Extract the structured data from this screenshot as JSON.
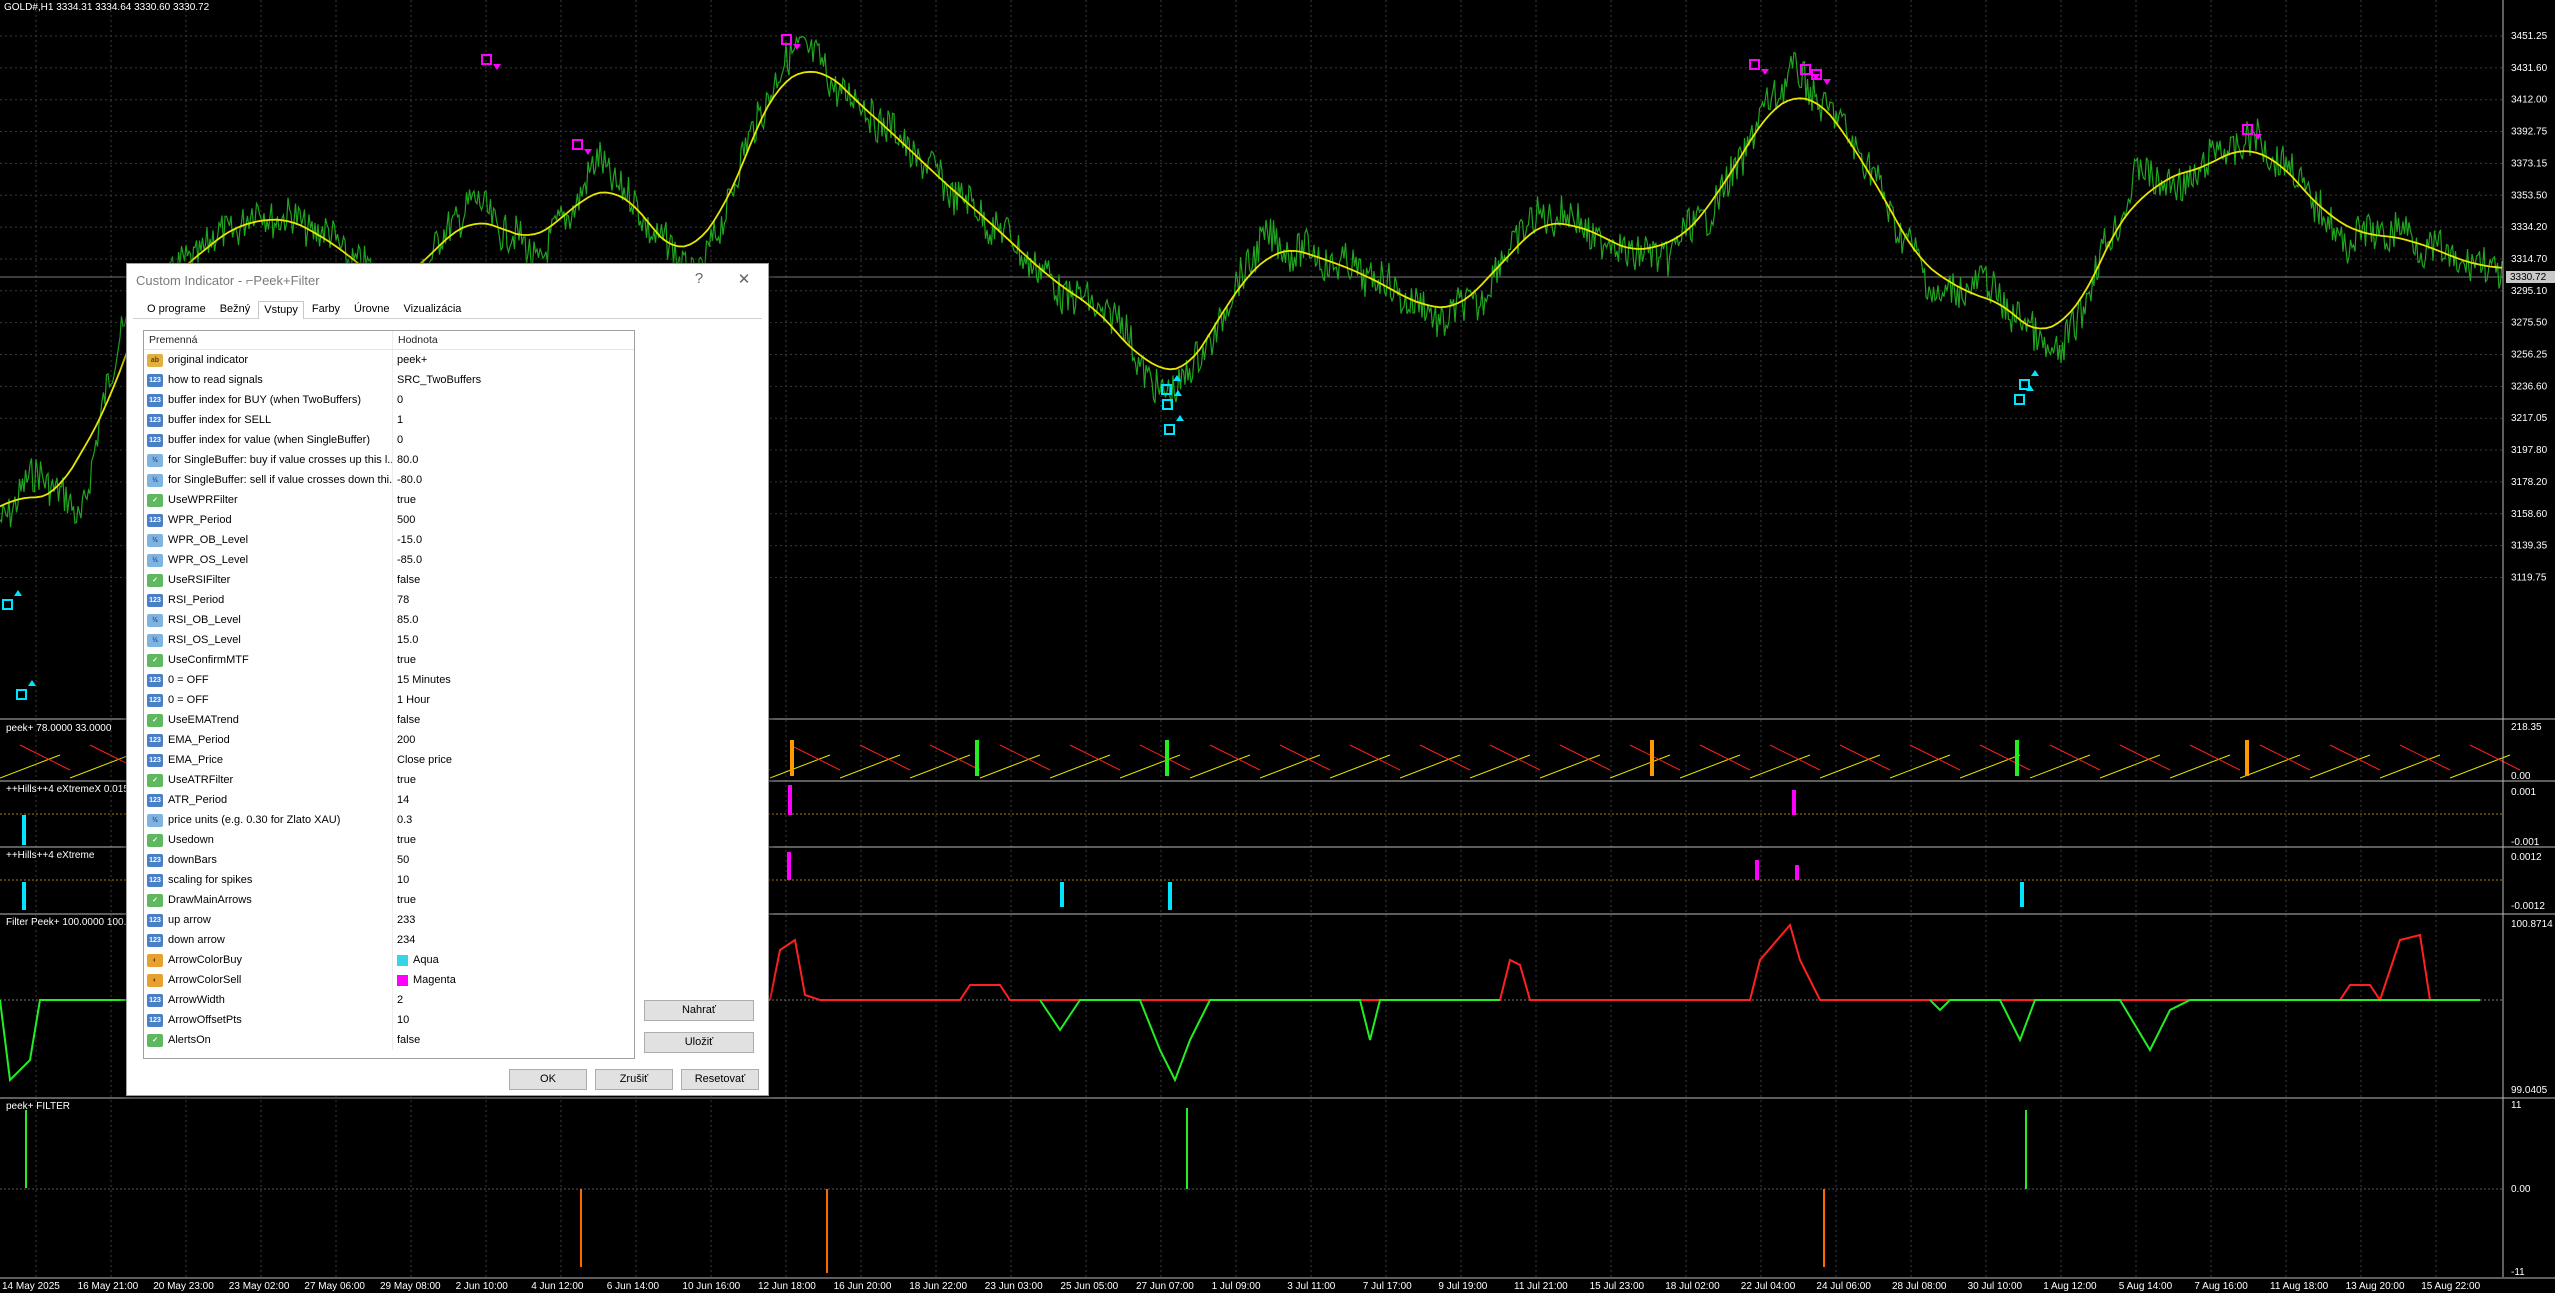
{
  "chart_header": "GOLD#,H1  3334.31 3334.64 3330.60 3330.72",
  "price_axis": [
    "3451.25",
    "3431.60",
    "3412.00",
    "3392.75",
    "3373.15",
    "3353.50",
    "3334.20",
    "3314.70",
    "3295.10",
    "3275.50",
    "3256.25",
    "3236.60",
    "3217.05",
    "3197.80",
    "3178.20",
    "3158.60",
    "3139.35",
    "3119.75"
  ],
  "current_price": "3330.72",
  "date_axis": [
    "14 May 2025",
    "16 May 21:00",
    "20 May 23:00",
    "23 May 02:00",
    "27 May 06:00",
    "29 May 08:00",
    "2 Jun 10:00",
    "4 Jun 12:00",
    "6 Jun 14:00",
    "10 Jun 16:00",
    "12 Jun 18:00",
    "16 Jun 20:00",
    "18 Jun 22:00",
    "23 Jun 03:00",
    "25 Jun 05:00",
    "27 Jun 07:00",
    "1 Jul 09:00",
    "3 Jul 11:00",
    "7 Jul 17:00",
    "9 Jul 19:00",
    "11 Jul 21:00",
    "15 Jul 23:00",
    "18 Jul 02:00",
    "22 Jul 04:00",
    "24 Jul 06:00",
    "28 Jul 08:00",
    "30 Jul 10:00",
    "1 Aug 12:00",
    "5 Aug 14:00",
    "7 Aug 16:00",
    "11 Aug 18:00",
    "13 Aug 20:00",
    "15 Aug 22:00"
  ],
  "subwindows": [
    {
      "label": "peek+ 78.0000 33.0000",
      "scale": [
        "218.35",
        "0.00"
      ]
    },
    {
      "label": "++Hills++4 eXtremeX 0.015",
      "scale": [
        "0.001",
        "-0.001"
      ]
    },
    {
      "label": "++Hills++4 eXtreme",
      "scale": [
        "0.0012",
        "-0.0012"
      ]
    },
    {
      "label": "Filter Peek+ 100.0000 100.0000",
      "scale": [
        "100.8714",
        "99.0405"
      ]
    },
    {
      "label": "peek+ FILTER",
      "scale": [
        "11",
        "0.00",
        "-11"
      ]
    }
  ],
  "dialog": {
    "title": "Custom Indicator - ⌐Peek+Filter",
    "help": "?",
    "close": "✕",
    "tabs": [
      "O programe",
      "Bežný",
      "Vstupy",
      "Farby",
      "Úrovne",
      "Vizualizácia"
    ],
    "active_tab": "Vstupy",
    "col_name": "Premenná",
    "col_value": "Hodnota",
    "params": [
      {
        "type": "ab",
        "name": "original indicator",
        "value": "peek+"
      },
      {
        "type": "enm",
        "name": "how to read signals",
        "value": "SRC_TwoBuffers"
      },
      {
        "type": "int",
        "name": "buffer index for BUY (when TwoBuffers)",
        "value": "0"
      },
      {
        "type": "int",
        "name": "buffer index for SELL",
        "value": "1"
      },
      {
        "type": "int",
        "name": "buffer index for value (when SingleBuffer)",
        "value": "0"
      },
      {
        "type": "dbl",
        "name": "for SingleBuffer: buy if value crosses up this l...",
        "value": "80.0"
      },
      {
        "type": "dbl",
        "name": "for SingleBuffer: sell if value crosses down thi...",
        "value": "-80.0"
      },
      {
        "type": "bool",
        "name": "UseWPRFilter",
        "value": "true"
      },
      {
        "type": "int",
        "name": "WPR_Period",
        "value": "500"
      },
      {
        "type": "dbl",
        "name": "WPR_OB_Level",
        "value": "-15.0"
      },
      {
        "type": "dbl",
        "name": "WPR_OS_Level",
        "value": "-85.0"
      },
      {
        "type": "bool",
        "name": "UseRSIFilter",
        "value": "false"
      },
      {
        "type": "int",
        "name": "RSI_Period",
        "value": "78"
      },
      {
        "type": "dbl",
        "name": "RSI_OB_Level",
        "value": "85.0"
      },
      {
        "type": "dbl",
        "name": "RSI_OS_Level",
        "value": "15.0"
      },
      {
        "type": "bool",
        "name": "UseConfirmMTF",
        "value": "true"
      },
      {
        "type": "enm",
        "name": "0 = OFF",
        "value": "15 Minutes"
      },
      {
        "type": "enm",
        "name": "0 = OFF",
        "value": "1 Hour"
      },
      {
        "type": "bool",
        "name": "UseEMATrend",
        "value": "false"
      },
      {
        "type": "int",
        "name": "EMA_Period",
        "value": "200"
      },
      {
        "type": "enm",
        "name": "EMA_Price",
        "value": "Close price"
      },
      {
        "type": "bool",
        "name": "UseATRFilter",
        "value": "true"
      },
      {
        "type": "int",
        "name": "ATR_Period",
        "value": "14"
      },
      {
        "type": "dbl",
        "name": "price units (e.g. 0.30 for Zlato XAU)",
        "value": "0.3"
      },
      {
        "type": "bool",
        "name": "Usedown",
        "value": "true"
      },
      {
        "type": "int",
        "name": "downBars",
        "value": "50"
      },
      {
        "type": "int",
        "name": "scaling for spikes",
        "value": "10"
      },
      {
        "type": "bool",
        "name": "DrawMainArrows",
        "value": "true"
      },
      {
        "type": "int",
        "name": "up arrow",
        "value": "233"
      },
      {
        "type": "int",
        "name": "down arrow",
        "value": "234"
      },
      {
        "type": "clr",
        "name": "ArrowColorBuy",
        "value": "Aqua",
        "swatch": "#33d6e6"
      },
      {
        "type": "clr",
        "name": "ArrowColorSell",
        "value": "Magenta",
        "swatch": "#ff00ff"
      },
      {
        "type": "int",
        "name": "ArrowWidth",
        "value": "2"
      },
      {
        "type": "int",
        "name": "ArrowOffsetPts",
        "value": "10"
      },
      {
        "type": "bool",
        "name": "AlertsOn",
        "value": "false"
      }
    ],
    "buttons": {
      "load": "Nahrať",
      "save": "Uložiť",
      "ok": "OK",
      "cancel": "Zrušiť",
      "reset": "Resetovať"
    }
  },
  "colors": {
    "price": "#1fa51f",
    "ma": "#e6e600",
    "buy": "#00e5ff",
    "sell": "#ff00ff",
    "grid": "#3a3a3a",
    "red": "#ff2020",
    "green": "#22ee22"
  }
}
